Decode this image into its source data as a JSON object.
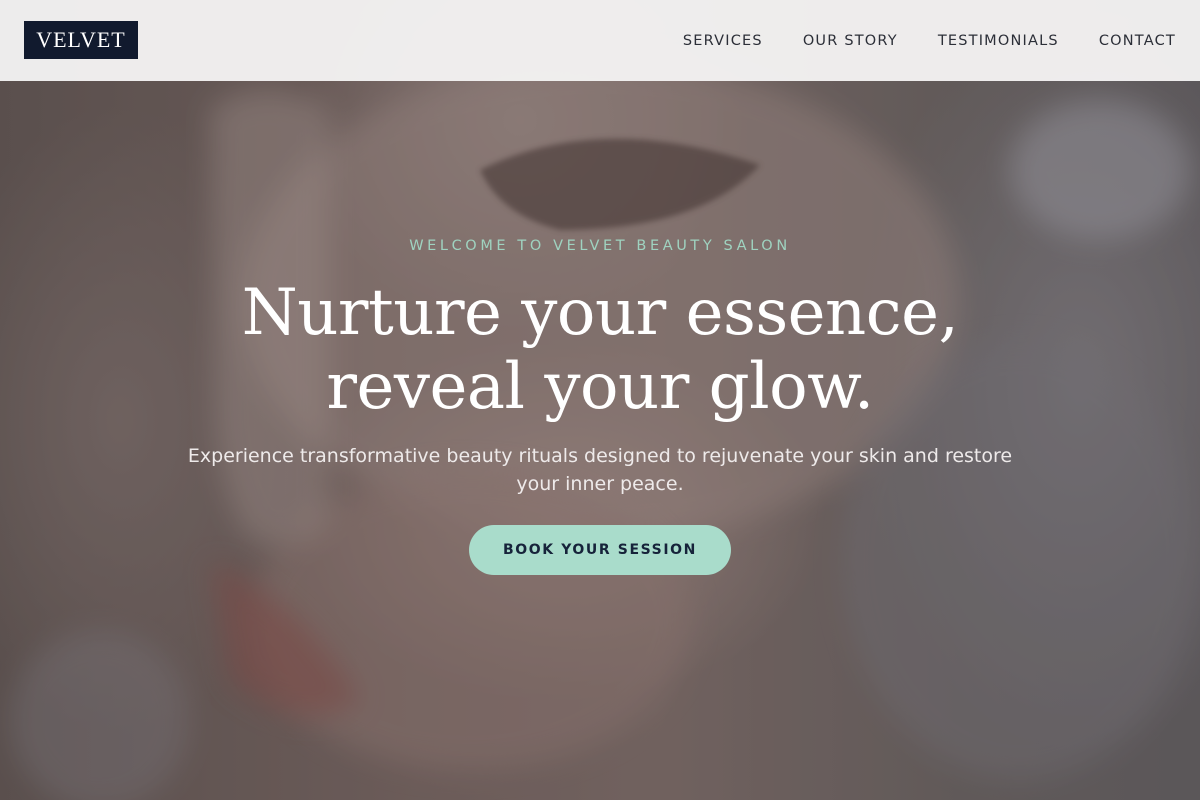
{
  "brand": {
    "logo_text": "VELVET"
  },
  "nav": {
    "items": [
      {
        "label": "SERVICES"
      },
      {
        "label": "OUR STORY"
      },
      {
        "label": "TESTIMONIALS"
      },
      {
        "label": "CONTACT"
      }
    ]
  },
  "hero": {
    "eyebrow": "WELCOME TO VELVET BEAUTY SALON",
    "headline_line1": "Nurture your essence,",
    "headline_line2": "reveal your glow.",
    "subtext": "Experience transformative beauty rituals designed to rejuvenate your skin and restore your inner peace.",
    "cta_label": "BOOK YOUR SESSION"
  },
  "colors": {
    "logo_bg": "#111a2e",
    "accent_mint": "#a9dccb",
    "eyebrow_mint": "#9fd3c0",
    "nav_text": "#2c2f38",
    "header_bg": "#f4f3f3"
  }
}
